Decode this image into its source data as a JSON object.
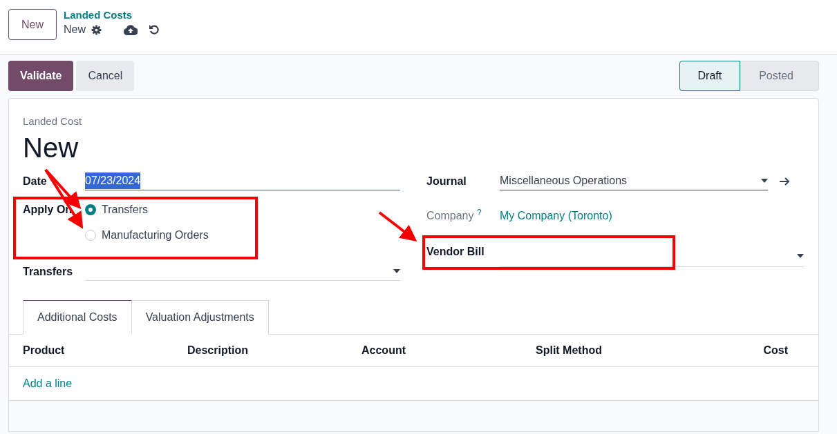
{
  "top_bar": {
    "new_button": "New",
    "breadcrumb": {
      "parent": "Landed Costs",
      "current": "New"
    }
  },
  "actions": [
    {
      "label": "Validate",
      "kind": "primary"
    },
    {
      "label": "Cancel",
      "kind": "secondary"
    }
  ],
  "statusbar": [
    {
      "label": "Draft",
      "selected": true
    },
    {
      "label": "Posted",
      "selected": false
    }
  ],
  "form": {
    "overline": "Landed Cost",
    "title": "New",
    "date": {
      "label": "Date",
      "value": "07/23/2024",
      "highlighted": true
    },
    "apply_on": {
      "label": "Apply On",
      "options": [
        {
          "label": "Transfers",
          "selected": true
        },
        {
          "label": "Manufacturing Orders",
          "selected": false
        }
      ]
    },
    "transfers": {
      "label": "Transfers"
    },
    "journal": {
      "label": "Journal",
      "value": "Miscellaneous Operations"
    },
    "company": {
      "label": "Company",
      "help": "?",
      "value": "My Company (Toronto)"
    },
    "vendor_bill": {
      "label": "Vendor Bill"
    }
  },
  "tabs": [
    {
      "label": "Additional Costs",
      "selected": true
    },
    {
      "label": "Valuation Adjustments",
      "selected": false
    }
  ],
  "table": {
    "columns": [
      "Product",
      "Description",
      "Account",
      "Split Method",
      "Cost"
    ],
    "add_line": "Add a line"
  }
}
